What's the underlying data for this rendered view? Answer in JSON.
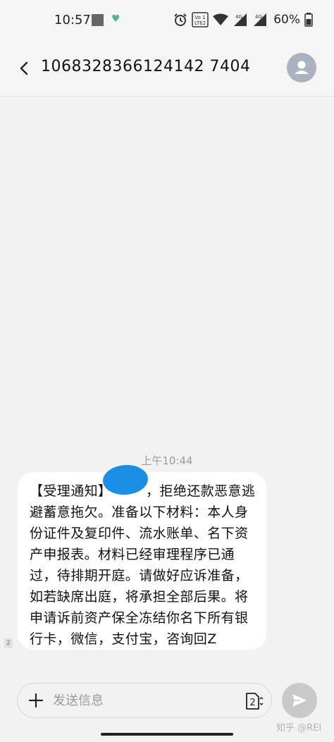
{
  "status_bar": {
    "time": "10:57",
    "volte_label": "Vo LTE",
    "network_1": "4G",
    "network_2": "4G",
    "battery_percent": "60%"
  },
  "header": {
    "phone_number": "1068328366124142 7404"
  },
  "conversation": {
    "timestamp": "上午10:44",
    "message_text": "【受理通知】　　　，拒绝还款恶意逃避蓄意拖欠。准备以下材料：本人身份证件及复印件、流水账单、名下资产申报表。材料已经审理程序已通过，待排期开庭。请做好应诉准备，如若缺席出庭，将承担全部后果。将申请诉前资产保全冻结你名下所有银行卡，微信，支付宝，咨询回Z",
    "sim_badge": "2"
  },
  "compose": {
    "placeholder": "发送信息",
    "sim_label": "2"
  },
  "watermark": "知乎 @REI",
  "colors": {
    "background": "#f2f2f2",
    "bubble": "#ffffff",
    "avatar": "#aab1bf",
    "redaction": "#1b8ee6",
    "send_button": "#c9c9c9"
  }
}
